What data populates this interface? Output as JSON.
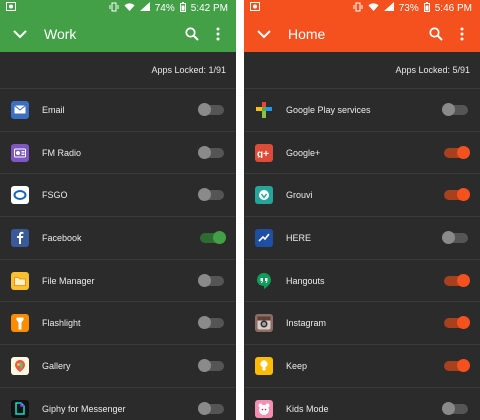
{
  "colors": {
    "work_accent": "#43a047",
    "work_track": "#2e6b31",
    "home_accent": "#f4511e",
    "home_track": "#a6401d"
  },
  "work": {
    "status": {
      "battery": "74%",
      "time": "5:42 PM"
    },
    "title": "Work",
    "apps_locked": "Apps Locked: 1/91",
    "apps": [
      {
        "label": "Email",
        "icon": "email-icon",
        "on": false
      },
      {
        "label": "FM Radio",
        "icon": "fm-radio-icon",
        "on": false
      },
      {
        "label": "FSGO",
        "icon": "fsgo-icon",
        "on": false
      },
      {
        "label": "Facebook",
        "icon": "facebook-icon",
        "on": true
      },
      {
        "label": "File Manager",
        "icon": "file-manager-icon",
        "on": false
      },
      {
        "label": "Flashlight",
        "icon": "flashlight-icon",
        "on": false
      },
      {
        "label": "Gallery",
        "icon": "gallery-icon",
        "on": false
      },
      {
        "label": "Giphy for Messenger",
        "icon": "giphy-icon",
        "on": false
      }
    ]
  },
  "home": {
    "status": {
      "battery": "73%",
      "time": "5:46 PM"
    },
    "title": "Home",
    "apps_locked": "Apps Locked: 5/91",
    "apps": [
      {
        "label": "Google Play services",
        "icon": "google-play-services-icon",
        "on": false
      },
      {
        "label": "Google+",
        "icon": "google-plus-icon",
        "on": true
      },
      {
        "label": "Grouvi",
        "icon": "grouvi-icon",
        "on": true
      },
      {
        "label": "HERE",
        "icon": "here-maps-icon",
        "on": false
      },
      {
        "label": "Hangouts",
        "icon": "hangouts-icon",
        "on": true
      },
      {
        "label": "Instagram",
        "icon": "instagram-icon",
        "on": true
      },
      {
        "label": "Keep",
        "icon": "keep-icon",
        "on": true
      },
      {
        "label": "Kids Mode",
        "icon": "kids-mode-icon",
        "on": false
      }
    ]
  }
}
